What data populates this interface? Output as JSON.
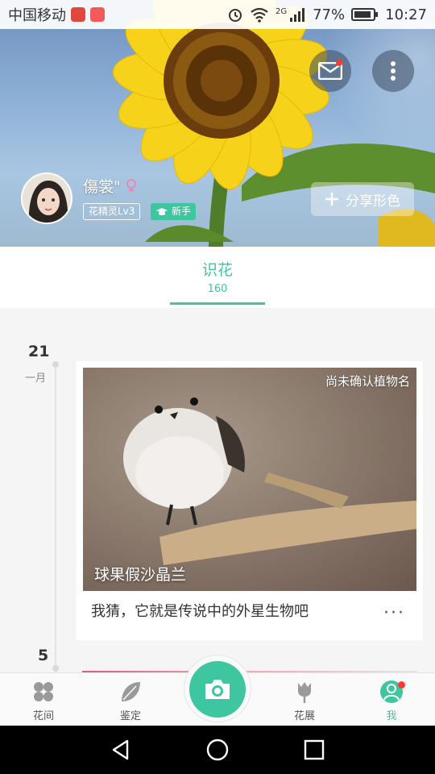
{
  "status_bar": {
    "carrier": "中国移动",
    "network": "2G",
    "battery": "77%",
    "time": "10:27"
  },
  "profile": {
    "username": "傷裳\"",
    "level": "花精灵Lv3",
    "badge": "新手",
    "share_label": "分享形色"
  },
  "tabs": [
    {
      "label": "识花",
      "count": "160"
    }
  ],
  "feed": [
    {
      "day": "21",
      "month": "一月",
      "status": "尚未确认植物名",
      "plant_name": "球果假沙晶兰",
      "caption": "我猜，它就是传说中的外星生物吧",
      "more": "···"
    },
    {
      "day": "5"
    }
  ],
  "bottom_nav": {
    "items": [
      {
        "label": "花间",
        "icon": "flower-grid-icon"
      },
      {
        "label": "鉴定",
        "icon": "leaf-icon"
      },
      {
        "label": "花展",
        "icon": "tulip-icon"
      },
      {
        "label": "我",
        "icon": "person-icon"
      }
    ],
    "active": "我"
  },
  "colors": {
    "accent": "#3ec6a0",
    "notification": "#ff3b30"
  }
}
